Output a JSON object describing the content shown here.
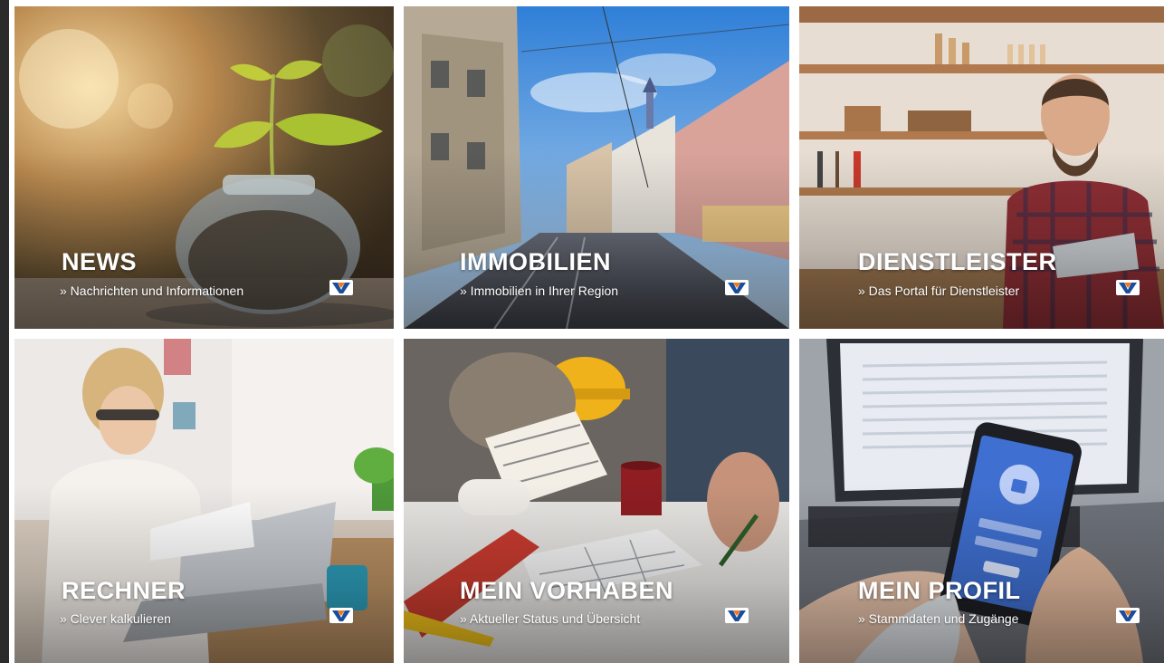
{
  "tiles": [
    {
      "title": "NEWS",
      "subtitle": "» Nachrichten und Informationen",
      "logo": "volksbank-logo-icon"
    },
    {
      "title": "IMMOBILIEN",
      "subtitle": "» Immobilien in Ihrer Region",
      "logo": "volksbank-logo-icon"
    },
    {
      "title": "DIENSTLEISTER",
      "subtitle": "» Das Portal für Dienstleister",
      "logo": "volksbank-logo-icon"
    },
    {
      "title": "RECHNER",
      "subtitle": "» Clever kalkulieren",
      "logo": "volksbank-logo-icon"
    },
    {
      "title": "MEIN VORHABEN",
      "subtitle": "» Aktueller Status und Übersicht",
      "logo": "volksbank-logo-icon"
    },
    {
      "title": "MEIN PROFIL",
      "subtitle": "» Stammdaten und Zugänge",
      "logo": "volksbank-logo-icon"
    }
  ],
  "colors": {
    "logo_blue": "#1a4e9c",
    "logo_orange": "#f0771b",
    "text": "#ffffff"
  }
}
